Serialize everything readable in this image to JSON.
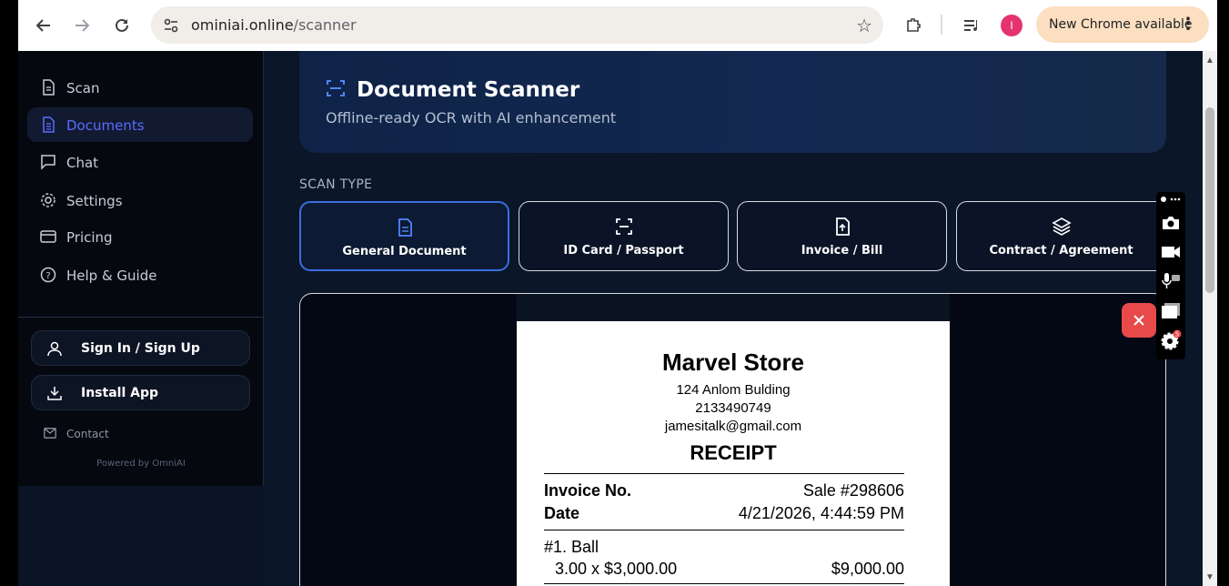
{
  "browser": {
    "url_domain": "ominiai.online",
    "url_path": "/scanner",
    "profile_initial": "I",
    "update_label": "New Chrome available"
  },
  "sidebar": {
    "items": [
      {
        "label": "Scan",
        "icon": "file-text-icon"
      },
      {
        "label": "Documents",
        "icon": "documents-icon",
        "active": true
      },
      {
        "label": "Chat",
        "icon": "chat-icon"
      },
      {
        "label": "Settings",
        "icon": "gear-icon"
      },
      {
        "label": "Pricing",
        "icon": "credit-card-icon"
      },
      {
        "label": "Help & Guide",
        "icon": "help-icon"
      }
    ],
    "sign_in_label": "Sign In / Sign Up",
    "install_label": "Install App",
    "contact_label": "Contact",
    "powered_by": "Powered by OmniAI"
  },
  "hero": {
    "title": "Document Scanner",
    "subtitle": "Offline-ready OCR with AI enhancement"
  },
  "scan_type": {
    "label": "SCAN TYPE",
    "options": [
      {
        "label": "General Document",
        "selected": true
      },
      {
        "label": "ID Card / Passport",
        "selected": false
      },
      {
        "label": "Invoice / Bill",
        "selected": false
      },
      {
        "label": "Contract / Agreement",
        "selected": false
      }
    ]
  },
  "receipt": {
    "store": "Marvel Store",
    "address": "124 Anlom Bulding",
    "phone": "2133490749",
    "email": "jamesitalk@gmail.com",
    "title": "RECEIPT",
    "invoice_label": "Invoice No.",
    "invoice_value": "Sale #298606",
    "date_label": "Date",
    "date_value": "4/21/2026, 4:44:59 PM",
    "item_name": "#1. Ball",
    "item_qty_price": "3.00 x $3,000.00",
    "item_total": "$9,000.00"
  },
  "float_tools": {
    "badge_count": "5"
  },
  "colors": {
    "accent": "#3b6fe0",
    "active_text": "#5b6cff",
    "close": "#e84a4a"
  }
}
